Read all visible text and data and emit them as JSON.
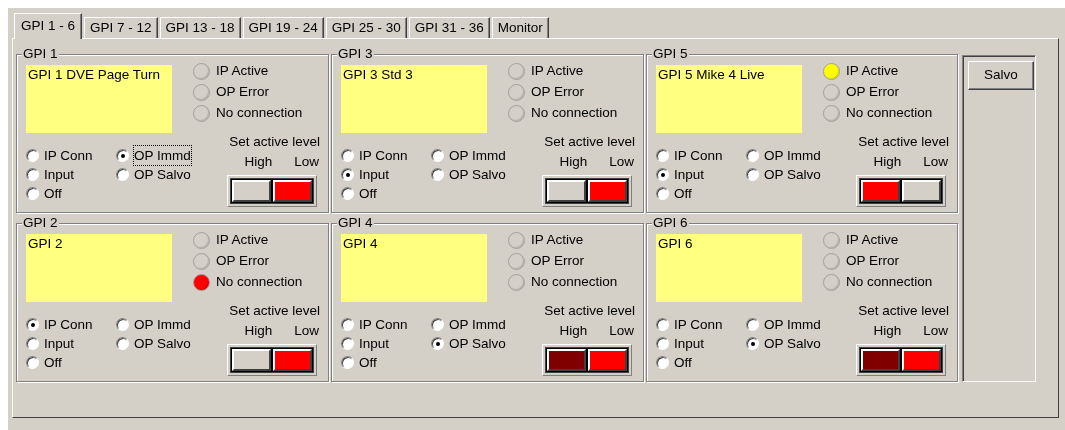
{
  "tabs": [
    {
      "label": "GPI 1 - 6",
      "selected": true
    },
    {
      "label": "GPI 7 - 12",
      "selected": false
    },
    {
      "label": "GPI 13 - 18",
      "selected": false
    },
    {
      "label": "GPI 19 - 24",
      "selected": false
    },
    {
      "label": "GPI 25 - 30",
      "selected": false
    },
    {
      "label": "GPI 31 - 36",
      "selected": false
    },
    {
      "label": "Monitor",
      "selected": false
    }
  ],
  "groups": [
    {
      "title": "GPI 1",
      "description": "GPI 1 DVE Page Turn",
      "lamps": [
        {
          "label": "IP Active",
          "color": "#d4d0c8"
        },
        {
          "label": "OP Error",
          "color": "#d4d0c8"
        },
        {
          "label": "No connection",
          "color": "#d4d0c8"
        }
      ],
      "modes": [
        {
          "label": "IP Conn",
          "selected": false,
          "focused": false
        },
        {
          "label": "OP Immd",
          "selected": true,
          "focused": true
        },
        {
          "label": "Input",
          "selected": false,
          "focused": false
        },
        {
          "label": "OP Salvo",
          "selected": false,
          "focused": false
        },
        {
          "label": "Off",
          "selected": false,
          "focused": false
        }
      ],
      "level": {
        "title": "Set active level",
        "high_label": "High",
        "low_label": "Low",
        "toggles": [
          {
            "color": "#d4d0c8"
          },
          {
            "color": "#ff0000"
          }
        ]
      }
    },
    {
      "title": "GPI 3",
      "description": "GPI 3 Std 3",
      "lamps": [
        {
          "label": "IP Active",
          "color": "#d4d0c8"
        },
        {
          "label": "OP Error",
          "color": "#d4d0c8"
        },
        {
          "label": "No connection",
          "color": "#d4d0c8"
        }
      ],
      "modes": [
        {
          "label": "IP Conn",
          "selected": false,
          "focused": false
        },
        {
          "label": "OP Immd",
          "selected": false,
          "focused": false
        },
        {
          "label": "Input",
          "selected": true,
          "focused": false
        },
        {
          "label": "OP Salvo",
          "selected": false,
          "focused": false
        },
        {
          "label": "Off",
          "selected": false,
          "focused": false
        }
      ],
      "level": {
        "title": "Set active level",
        "high_label": "High",
        "low_label": "Low",
        "toggles": [
          {
            "color": "#d4d0c8"
          },
          {
            "color": "#ff0000"
          }
        ]
      }
    },
    {
      "title": "GPI 5",
      "description": "GPI 5 Mike 4 Live",
      "lamps": [
        {
          "label": "IP Active",
          "color": "#ffff00"
        },
        {
          "label": "OP Error",
          "color": "#d4d0c8"
        },
        {
          "label": "No connection",
          "color": "#d4d0c8"
        }
      ],
      "modes": [
        {
          "label": "IP Conn",
          "selected": false,
          "focused": false
        },
        {
          "label": "OP Immd",
          "selected": false,
          "focused": false
        },
        {
          "label": "Input",
          "selected": true,
          "focused": false
        },
        {
          "label": "OP Salvo",
          "selected": false,
          "focused": false
        },
        {
          "label": "Off",
          "selected": false,
          "focused": false
        }
      ],
      "level": {
        "title": "Set active level",
        "high_label": "High",
        "low_label": "Low",
        "toggles": [
          {
            "color": "#ff0000"
          },
          {
            "color": "#d4d0c8"
          }
        ]
      }
    },
    {
      "title": "GPI 2",
      "description": "GPI 2",
      "lamps": [
        {
          "label": "IP Active",
          "color": "#d4d0c8"
        },
        {
          "label": "OP Error",
          "color": "#d4d0c8"
        },
        {
          "label": "No connection",
          "color": "#ff0000"
        }
      ],
      "modes": [
        {
          "label": "IP Conn",
          "selected": true,
          "focused": false
        },
        {
          "label": "OP Immd",
          "selected": false,
          "focused": false
        },
        {
          "label": "Input",
          "selected": false,
          "focused": false
        },
        {
          "label": "OP Salvo",
          "selected": false,
          "focused": false
        },
        {
          "label": "Off",
          "selected": false,
          "focused": false
        }
      ],
      "level": {
        "title": "Set active level",
        "high_label": "High",
        "low_label": "Low",
        "toggles": [
          {
            "color": "#d4d0c8"
          },
          {
            "color": "#ff0000"
          }
        ]
      }
    },
    {
      "title": "GPI 4",
      "description": "GPI 4",
      "lamps": [
        {
          "label": "IP Active",
          "color": "#d4d0c8"
        },
        {
          "label": "OP Error",
          "color": "#d4d0c8"
        },
        {
          "label": "No connection",
          "color": "#d4d0c8"
        }
      ],
      "modes": [
        {
          "label": "IP Conn",
          "selected": false,
          "focused": false
        },
        {
          "label": "OP Immd",
          "selected": false,
          "focused": false
        },
        {
          "label": "Input",
          "selected": false,
          "focused": false
        },
        {
          "label": "OP Salvo",
          "selected": true,
          "focused": false
        },
        {
          "label": "Off",
          "selected": false,
          "focused": false
        }
      ],
      "level": {
        "title": "Set active level",
        "high_label": "High",
        "low_label": "Low",
        "toggles": [
          {
            "color": "#800000"
          },
          {
            "color": "#ff0000"
          }
        ]
      }
    },
    {
      "title": "GPI 6",
      "description": "GPI 6",
      "lamps": [
        {
          "label": "IP Active",
          "color": "#d4d0c8"
        },
        {
          "label": "OP Error",
          "color": "#d4d0c8"
        },
        {
          "label": "No connection",
          "color": "#d4d0c8"
        }
      ],
      "modes": [
        {
          "label": "IP Conn",
          "selected": false,
          "focused": false
        },
        {
          "label": "OP Immd",
          "selected": false,
          "focused": false
        },
        {
          "label": "Input",
          "selected": false,
          "focused": false
        },
        {
          "label": "OP Salvo",
          "selected": true,
          "focused": false
        },
        {
          "label": "Off",
          "selected": false,
          "focused": false
        }
      ],
      "level": {
        "title": "Set active level",
        "high_label": "High",
        "low_label": "Low",
        "toggles": [
          {
            "color": "#800000"
          },
          {
            "color": "#ff0000"
          }
        ]
      }
    }
  ],
  "salvo_button": "Salvo"
}
